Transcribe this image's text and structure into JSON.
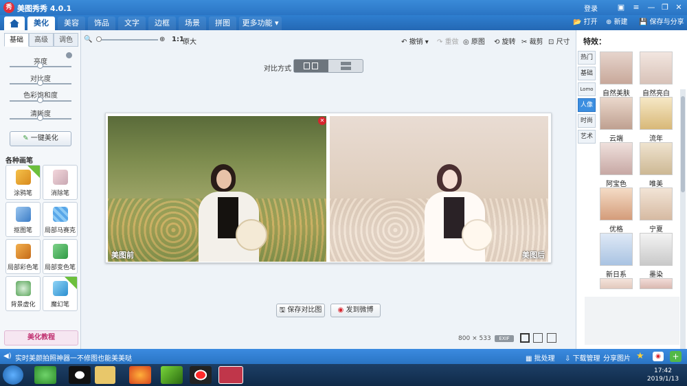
{
  "app": {
    "logo": "秀",
    "title": "美图秀秀 4.0.1",
    "login": "登录"
  },
  "menu": {
    "tabs": [
      "美化",
      "美容",
      "饰品",
      "文字",
      "边框",
      "场景",
      "拼图",
      "更多功能 ▾"
    ],
    "active_tab": "美化"
  },
  "top_actions": {
    "open": "打开",
    "new": "新建",
    "save_share": "保存与分享"
  },
  "left_panel": {
    "tabs": [
      "基础",
      "高级",
      "调色"
    ],
    "sliders": [
      {
        "label": "亮度",
        "value": 0.5
      },
      {
        "label": "对比度",
        "value": 0.5
      },
      {
        "label": "色彩饱和度",
        "value": 0.5
      },
      {
        "label": "清晰度",
        "value": 0.5
      }
    ],
    "one_key_button": "一键美化",
    "brush_section_title": "各种画笔",
    "brushes": [
      {
        "label": "涂鸦笔",
        "badge": "升级"
      },
      {
        "label": "消除笔",
        "badge": ""
      },
      {
        "label": "抠图笔",
        "badge": ""
      },
      {
        "label": "局部马赛克",
        "badge": ""
      },
      {
        "label": "局部彩色笔",
        "badge": ""
      },
      {
        "label": "局部变色笔",
        "badge": ""
      },
      {
        "label": "背景虚化",
        "badge": ""
      },
      {
        "label": "魔幻笔",
        "badge": "new"
      }
    ],
    "tutorial_button": "美化教程"
  },
  "toolbar": {
    "zoom_ratio": "1:1",
    "original_size": "原大",
    "undo": "撤销",
    "redo": "重做",
    "original": "原图",
    "rotate": "旋转",
    "crop": "裁剪",
    "resize": "尺寸"
  },
  "compare": {
    "label": "对比方式",
    "mode": "side-by-side"
  },
  "photos": {
    "before_label": "美图前",
    "after_label": "美图后"
  },
  "bottom_buttons": {
    "save_compare": "保存对比图",
    "post_weibo": "发到微博"
  },
  "image_info": {
    "width": "800",
    "times": "×",
    "height": "533",
    "exif": "EXIF"
  },
  "effects": {
    "title": "特效：",
    "categories": [
      "热门",
      "基础",
      "Lomo",
      "人像",
      "时尚",
      "艺术"
    ],
    "active_category": "人像",
    "items": [
      "自然美肤",
      "自然亮白",
      "云端",
      "流年",
      "阿宝色",
      "唯美",
      "优格",
      "宁夏",
      "新日系",
      "墨染"
    ]
  },
  "statusbar": {
    "message": "实时美颜拍照神器一不修图也能美美哒",
    "batch": "批处理",
    "download": "下载管理",
    "share": "分享图片"
  },
  "taskbar": {
    "time": "17:42",
    "date": "2019/1/13"
  },
  "colors": {
    "accent": "#2a74c4",
    "title_bar": "#3a8bd8",
    "active_category": "#3c8ee0",
    "close": "#d8252e"
  }
}
